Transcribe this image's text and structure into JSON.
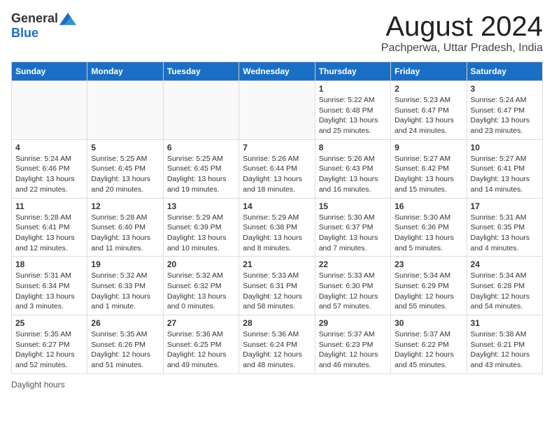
{
  "header": {
    "logo_general": "General",
    "logo_blue": "Blue",
    "month_title": "August 2024",
    "location": "Pachperwa, Uttar Pradesh, India"
  },
  "days_of_week": [
    "Sunday",
    "Monday",
    "Tuesday",
    "Wednesday",
    "Thursday",
    "Friday",
    "Saturday"
  ],
  "weeks": [
    [
      {
        "day": "",
        "sunrise": "",
        "sunset": "",
        "daylight": ""
      },
      {
        "day": "",
        "sunrise": "",
        "sunset": "",
        "daylight": ""
      },
      {
        "day": "",
        "sunrise": "",
        "sunset": "",
        "daylight": ""
      },
      {
        "day": "",
        "sunrise": "",
        "sunset": "",
        "daylight": ""
      },
      {
        "day": "1",
        "sunrise": "Sunrise: 5:22 AM",
        "sunset": "Sunset: 6:48 PM",
        "daylight": "Daylight: 13 hours and 25 minutes."
      },
      {
        "day": "2",
        "sunrise": "Sunrise: 5:23 AM",
        "sunset": "Sunset: 6:47 PM",
        "daylight": "Daylight: 13 hours and 24 minutes."
      },
      {
        "day": "3",
        "sunrise": "Sunrise: 5:24 AM",
        "sunset": "Sunset: 6:47 PM",
        "daylight": "Daylight: 13 hours and 23 minutes."
      }
    ],
    [
      {
        "day": "4",
        "sunrise": "Sunrise: 5:24 AM",
        "sunset": "Sunset: 6:46 PM",
        "daylight": "Daylight: 13 hours and 22 minutes."
      },
      {
        "day": "5",
        "sunrise": "Sunrise: 5:25 AM",
        "sunset": "Sunset: 6:45 PM",
        "daylight": "Daylight: 13 hours and 20 minutes."
      },
      {
        "day": "6",
        "sunrise": "Sunrise: 5:25 AM",
        "sunset": "Sunset: 6:45 PM",
        "daylight": "Daylight: 13 hours and 19 minutes."
      },
      {
        "day": "7",
        "sunrise": "Sunrise: 5:26 AM",
        "sunset": "Sunset: 6:44 PM",
        "daylight": "Daylight: 13 hours and 18 minutes."
      },
      {
        "day": "8",
        "sunrise": "Sunrise: 5:26 AM",
        "sunset": "Sunset: 6:43 PM",
        "daylight": "Daylight: 13 hours and 16 minutes."
      },
      {
        "day": "9",
        "sunrise": "Sunrise: 5:27 AM",
        "sunset": "Sunset: 6:42 PM",
        "daylight": "Daylight: 13 hours and 15 minutes."
      },
      {
        "day": "10",
        "sunrise": "Sunrise: 5:27 AM",
        "sunset": "Sunset: 6:41 PM",
        "daylight": "Daylight: 13 hours and 14 minutes."
      }
    ],
    [
      {
        "day": "11",
        "sunrise": "Sunrise: 5:28 AM",
        "sunset": "Sunset: 6:41 PM",
        "daylight": "Daylight: 13 hours and 12 minutes."
      },
      {
        "day": "12",
        "sunrise": "Sunrise: 5:28 AM",
        "sunset": "Sunset: 6:40 PM",
        "daylight": "Daylight: 13 hours and 11 minutes."
      },
      {
        "day": "13",
        "sunrise": "Sunrise: 5:29 AM",
        "sunset": "Sunset: 6:39 PM",
        "daylight": "Daylight: 13 hours and 10 minutes."
      },
      {
        "day": "14",
        "sunrise": "Sunrise: 5:29 AM",
        "sunset": "Sunset: 6:38 PM",
        "daylight": "Daylight: 13 hours and 8 minutes."
      },
      {
        "day": "15",
        "sunrise": "Sunrise: 5:30 AM",
        "sunset": "Sunset: 6:37 PM",
        "daylight": "Daylight: 13 hours and 7 minutes."
      },
      {
        "day": "16",
        "sunrise": "Sunrise: 5:30 AM",
        "sunset": "Sunset: 6:36 PM",
        "daylight": "Daylight: 13 hours and 5 minutes."
      },
      {
        "day": "17",
        "sunrise": "Sunrise: 5:31 AM",
        "sunset": "Sunset: 6:35 PM",
        "daylight": "Daylight: 13 hours and 4 minutes."
      }
    ],
    [
      {
        "day": "18",
        "sunrise": "Sunrise: 5:31 AM",
        "sunset": "Sunset: 6:34 PM",
        "daylight": "Daylight: 13 hours and 3 minutes."
      },
      {
        "day": "19",
        "sunrise": "Sunrise: 5:32 AM",
        "sunset": "Sunset: 6:33 PM",
        "daylight": "Daylight: 13 hours and 1 minute."
      },
      {
        "day": "20",
        "sunrise": "Sunrise: 5:32 AM",
        "sunset": "Sunset: 6:32 PM",
        "daylight": "Daylight: 13 hours and 0 minutes."
      },
      {
        "day": "21",
        "sunrise": "Sunrise: 5:33 AM",
        "sunset": "Sunset: 6:31 PM",
        "daylight": "Daylight: 12 hours and 58 minutes."
      },
      {
        "day": "22",
        "sunrise": "Sunrise: 5:33 AM",
        "sunset": "Sunset: 6:30 PM",
        "daylight": "Daylight: 12 hours and 57 minutes."
      },
      {
        "day": "23",
        "sunrise": "Sunrise: 5:34 AM",
        "sunset": "Sunset: 6:29 PM",
        "daylight": "Daylight: 12 hours and 55 minutes."
      },
      {
        "day": "24",
        "sunrise": "Sunrise: 5:34 AM",
        "sunset": "Sunset: 6:28 PM",
        "daylight": "Daylight: 12 hours and 54 minutes."
      }
    ],
    [
      {
        "day": "25",
        "sunrise": "Sunrise: 5:35 AM",
        "sunset": "Sunset: 6:27 PM",
        "daylight": "Daylight: 12 hours and 52 minutes."
      },
      {
        "day": "26",
        "sunrise": "Sunrise: 5:35 AM",
        "sunset": "Sunset: 6:26 PM",
        "daylight": "Daylight: 12 hours and 51 minutes."
      },
      {
        "day": "27",
        "sunrise": "Sunrise: 5:36 AM",
        "sunset": "Sunset: 6:25 PM",
        "daylight": "Daylight: 12 hours and 49 minutes."
      },
      {
        "day": "28",
        "sunrise": "Sunrise: 5:36 AM",
        "sunset": "Sunset: 6:24 PM",
        "daylight": "Daylight: 12 hours and 48 minutes."
      },
      {
        "day": "29",
        "sunrise": "Sunrise: 5:37 AM",
        "sunset": "Sunset: 6:23 PM",
        "daylight": "Daylight: 12 hours and 46 minutes."
      },
      {
        "day": "30",
        "sunrise": "Sunrise: 5:37 AM",
        "sunset": "Sunset: 6:22 PM",
        "daylight": "Daylight: 12 hours and 45 minutes."
      },
      {
        "day": "31",
        "sunrise": "Sunrise: 5:38 AM",
        "sunset": "Sunset: 6:21 PM",
        "daylight": "Daylight: 12 hours and 43 minutes."
      }
    ]
  ],
  "footer": {
    "note": "Daylight hours"
  }
}
